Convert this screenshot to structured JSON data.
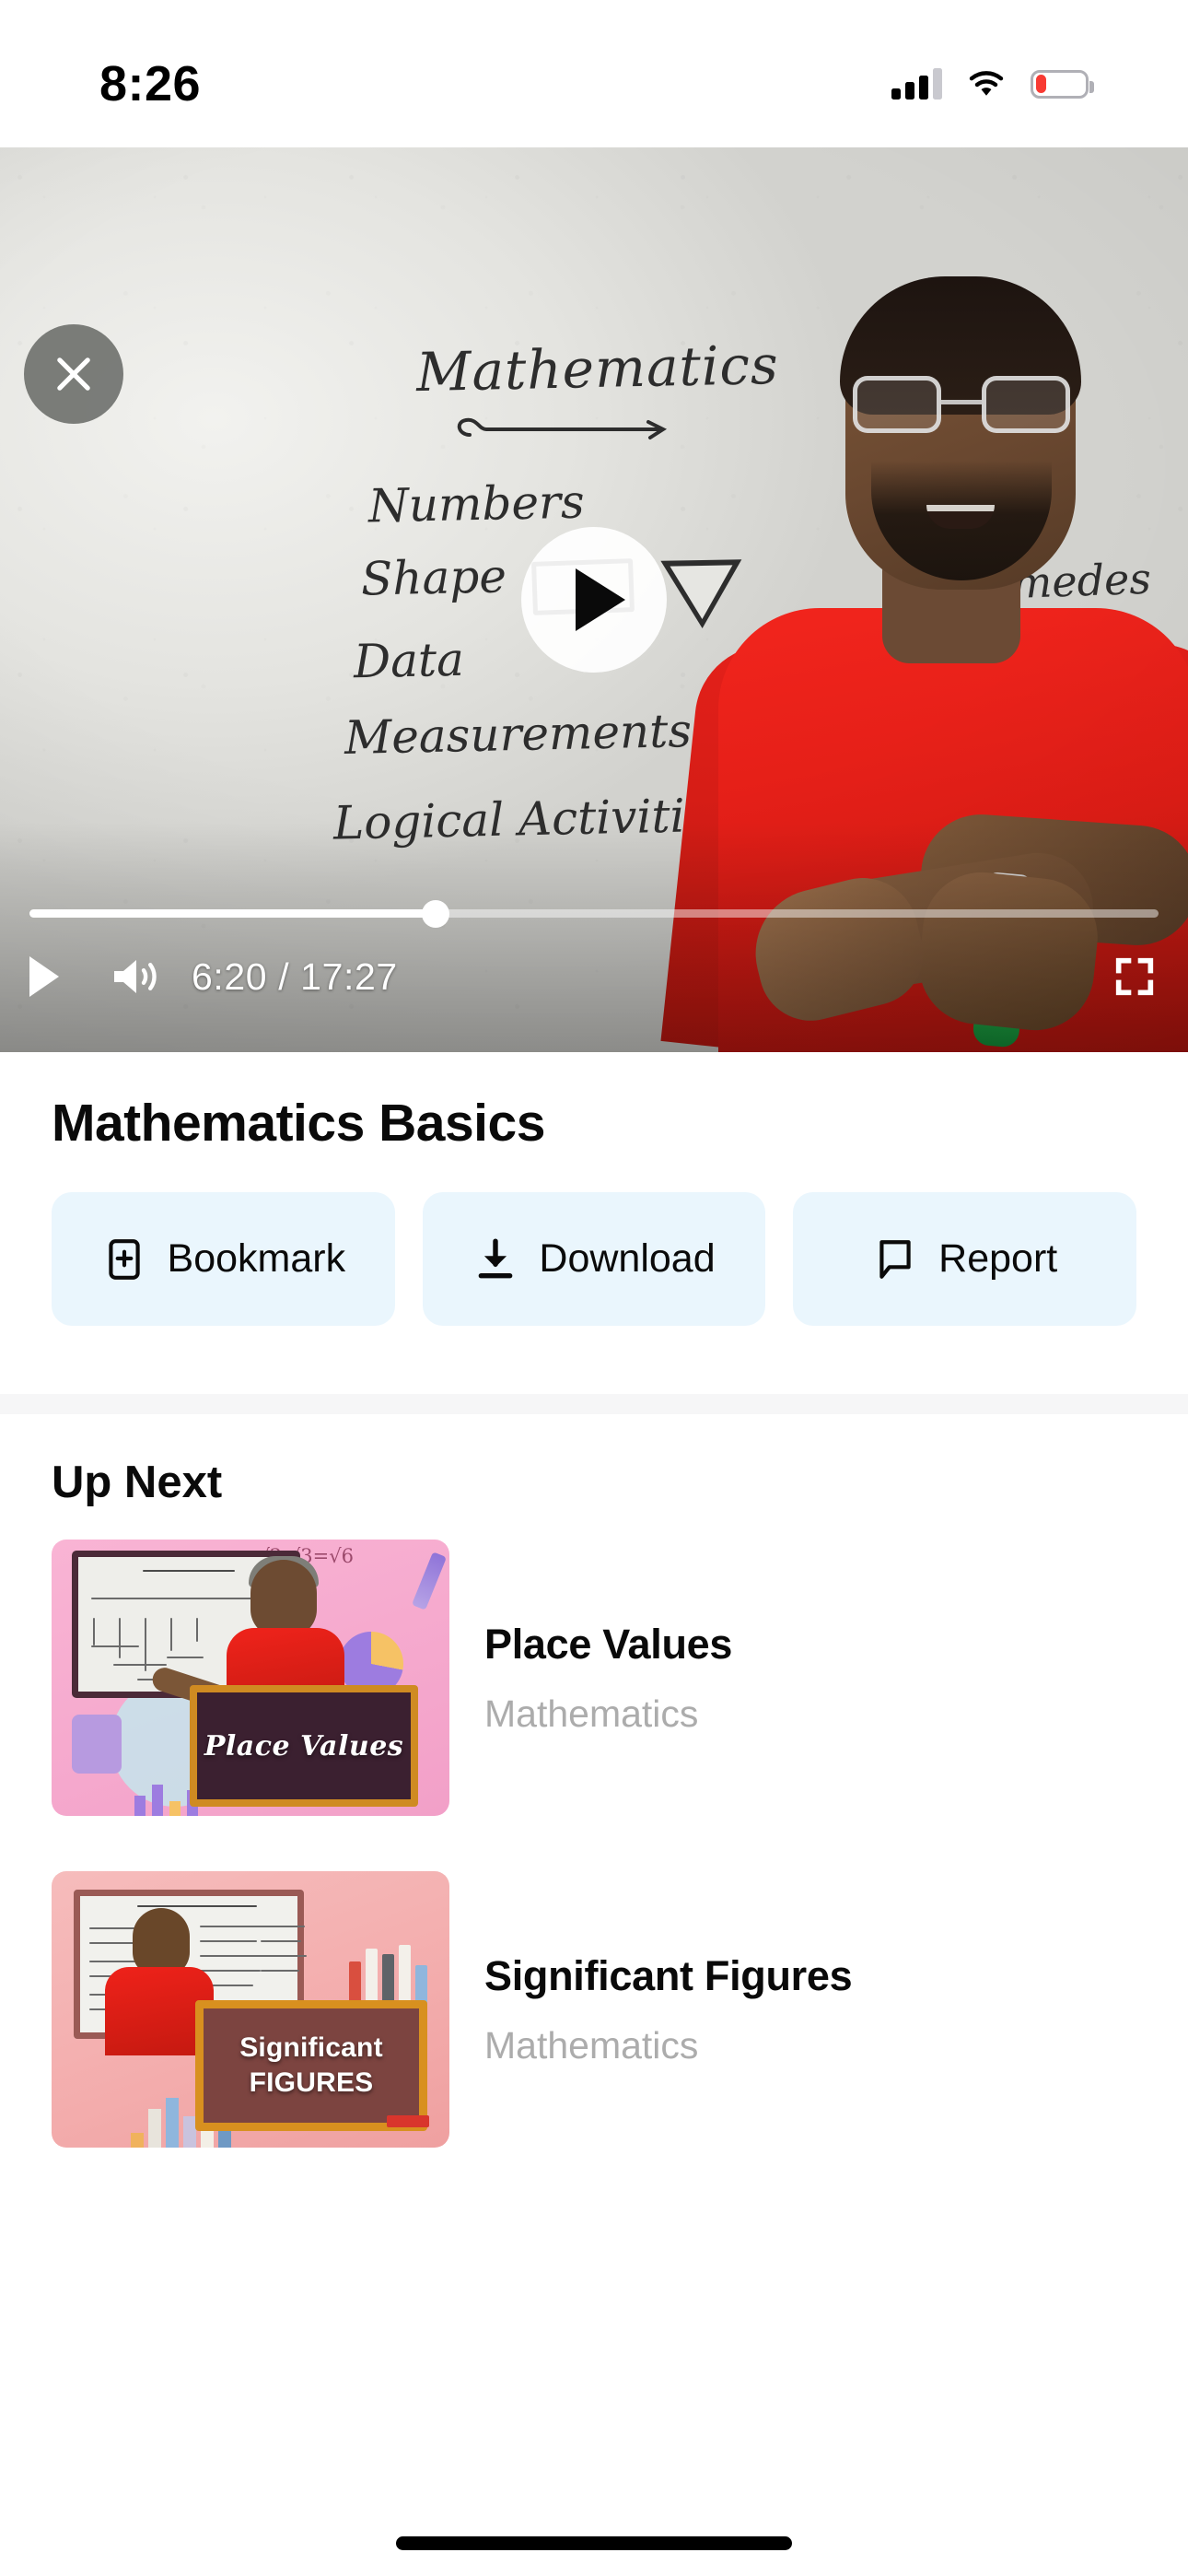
{
  "status_bar": {
    "time": "8:26",
    "signal_icon": "cellular-signal-icon",
    "signal_bars_filled": 3,
    "signal_bars_total": 4,
    "wifi_icon": "wifi-icon",
    "battery_icon": "battery-low-icon",
    "battery_level_percent": 22,
    "battery_color": "#f83a33"
  },
  "player": {
    "close_icon": "close-icon",
    "play_overlay_icon": "play-icon",
    "controls": {
      "play_icon": "play-icon",
      "volume_icon": "volume-on-icon",
      "time_display": "6:20 / 17:27",
      "current_time": "6:20",
      "duration": "17:27",
      "progress_percent": 36,
      "fullscreen_icon": "fullscreen-icon"
    },
    "whiteboard": {
      "title": "Mathematics",
      "lines": [
        "Numbers",
        "Shape",
        "Data",
        "Measurements",
        "Logical Activities"
      ],
      "side_note": "rimedes"
    }
  },
  "info": {
    "title": "Mathematics Basics",
    "actions": [
      {
        "label": "Bookmark",
        "icon": "bookmark-add-icon"
      },
      {
        "label": "Download",
        "icon": "download-icon"
      },
      {
        "label": "Report",
        "icon": "report-flag-icon"
      }
    ],
    "action_bg_color": "#eaf6fd"
  },
  "up_next": {
    "heading": "Up Next",
    "items": [
      {
        "title": "Place Values",
        "subject": "Mathematics",
        "thumbnail_overlay_text": "Place Values",
        "thumbnail_board_title": "Place Values",
        "thumbnail_bg_color": "#f5a8cd"
      },
      {
        "title": "Significant Figures",
        "subject": "Mathematics",
        "thumbnail_overlay_line1": "Significant",
        "thumbnail_overlay_line2": "FIGURES",
        "thumbnail_board_title": "SIGNIFICANT FIGURES",
        "thumbnail_bg_color": "#f3acac"
      }
    ]
  },
  "home_indicator": "home-indicator"
}
